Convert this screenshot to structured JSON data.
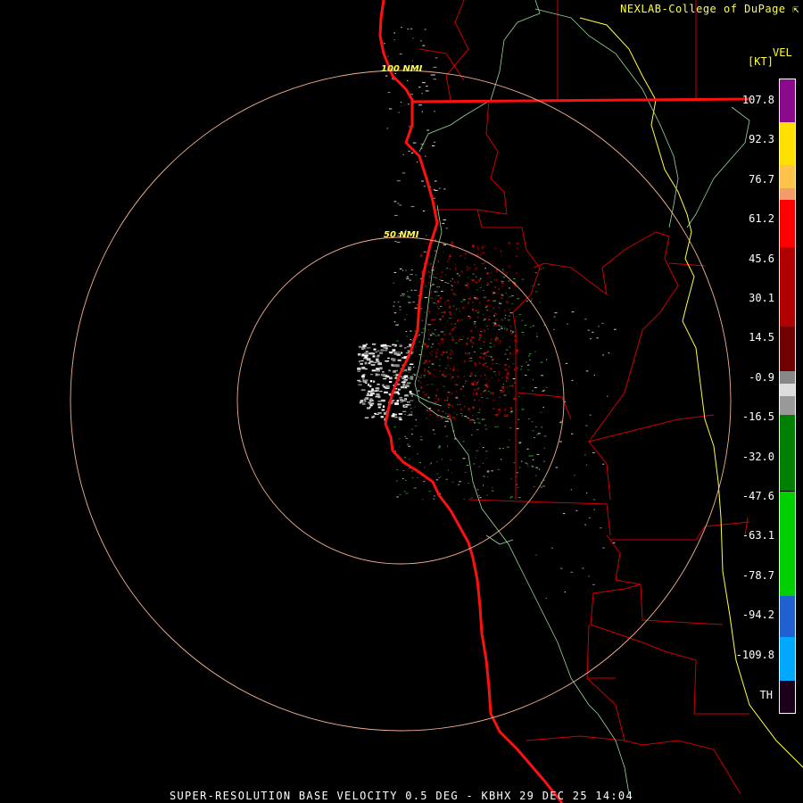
{
  "credit": "NEXLAB-College of DuPage",
  "credit_icon": "cursor-arrow-icon",
  "product_label": "VEL",
  "units_label": "[KT]",
  "colorbar": {
    "ticks": [
      "107.8",
      "92.3",
      "76.7",
      "61.2",
      "45.6",
      "30.1",
      "14.5",
      "-0.9",
      "-16.5",
      "-32.0",
      "-47.6",
      "-63.1",
      "-78.7",
      "-94.2",
      "-109.8"
    ],
    "bottom_label": "TH",
    "segments": [
      {
        "from": 0.0,
        "to": 0.067,
        "color": "#8b0a8b"
      },
      {
        "from": 0.067,
        "to": 0.135,
        "color": "#ffe000"
      },
      {
        "from": 0.135,
        "to": 0.172,
        "color": "#ffc24a"
      },
      {
        "from": 0.172,
        "to": 0.19,
        "color": "#f39c6a"
      },
      {
        "from": 0.19,
        "to": 0.265,
        "color": "#ff0000"
      },
      {
        "from": 0.265,
        "to": 0.39,
        "color": "#b00000"
      },
      {
        "from": 0.39,
        "to": 0.46,
        "color": "#700000"
      },
      {
        "from": 0.46,
        "to": 0.48,
        "color": "#888888"
      },
      {
        "from": 0.48,
        "to": 0.5,
        "color": "#dddddd"
      },
      {
        "from": 0.5,
        "to": 0.53,
        "color": "#999999"
      },
      {
        "from": 0.53,
        "to": 0.65,
        "color": "#008000"
      },
      {
        "from": 0.65,
        "to": 0.815,
        "color": "#00d000"
      },
      {
        "from": 0.815,
        "to": 0.88,
        "color": "#2060d0"
      },
      {
        "from": 0.88,
        "to": 0.95,
        "color": "#00a8ff"
      },
      {
        "from": 0.95,
        "to": 1.0,
        "color": "#1a001a"
      }
    ]
  },
  "range_rings": [
    {
      "label": "50 NMI"
    },
    {
      "label": "100 NMI"
    }
  ],
  "caption": "SUPER-RESOLUTION BASE VELOCITY 0.5 DEG - KBHX 29 DEC 25 14:04",
  "colors": {
    "coastline": "#ff1010",
    "county_lines": "#cc0000",
    "rivers": "#9ad89a",
    "state_line": "#ffff40",
    "range_rings": "#f0b090"
  }
}
